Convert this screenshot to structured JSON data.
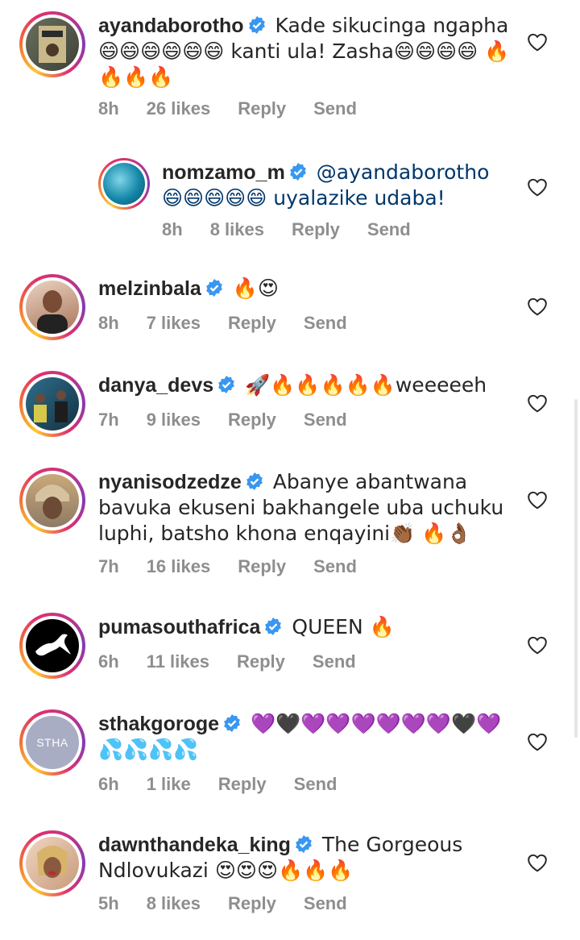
{
  "comments": [
    {
      "username": "ayandaborotho",
      "text": "Kade sikucinga ngapha 😄😄😄😄😄😄 kanti ula! Zasha😄😄😄😄 🔥🔥🔥🔥",
      "time": "8h",
      "likes": "26 likes",
      "reply": "Reply",
      "send": "Send"
    },
    {
      "username": "nomzamo_m",
      "text": "@ayandaborotho 😄😄😄😄😄 uyalazike udaba!",
      "time": "8h",
      "likes": "8 likes",
      "reply": "Reply",
      "send": "Send"
    },
    {
      "username": "melzinbala",
      "text": "🔥😍",
      "time": "8h",
      "likes": "7 likes",
      "reply": "Reply",
      "send": "Send"
    },
    {
      "username": "danya_devs",
      "text": "🚀🔥🔥🔥🔥🔥weeeeeh",
      "time": "7h",
      "likes": "9 likes",
      "reply": "Reply",
      "send": "Send"
    },
    {
      "username": "nyanisodzedze",
      "text": "Abanye abantwana bavuka ekuseni bakhangele uba uchuku luphi, batsho khona enqayini👏🏾 🔥👌🏾",
      "time": "7h",
      "likes": "16 likes",
      "reply": "Reply",
      "send": "Send"
    },
    {
      "username": "pumasouthafrica",
      "text": "QUEEN 🔥",
      "time": "6h",
      "likes": "11 likes",
      "reply": "Reply",
      "send": "Send"
    },
    {
      "username": "sthakgoroge",
      "text": "💜🖤💜💜💜💜💜💜🖤💜💦💦💦💦",
      "time": "6h",
      "likes": "1 like",
      "reply": "Reply",
      "send": "Send",
      "avatar_text": "STHA"
    },
    {
      "username": "dawnthandeka_king",
      "text": "The Gorgeous Ndlovukazi 😍😍😍🔥🔥🔥",
      "time": "5h",
      "likes": "8 likes",
      "reply": "Reply",
      "send": "Send"
    }
  ],
  "colors": {
    "verified": "#3897f0",
    "meta": "#8e8e8e",
    "text": "#262626"
  }
}
